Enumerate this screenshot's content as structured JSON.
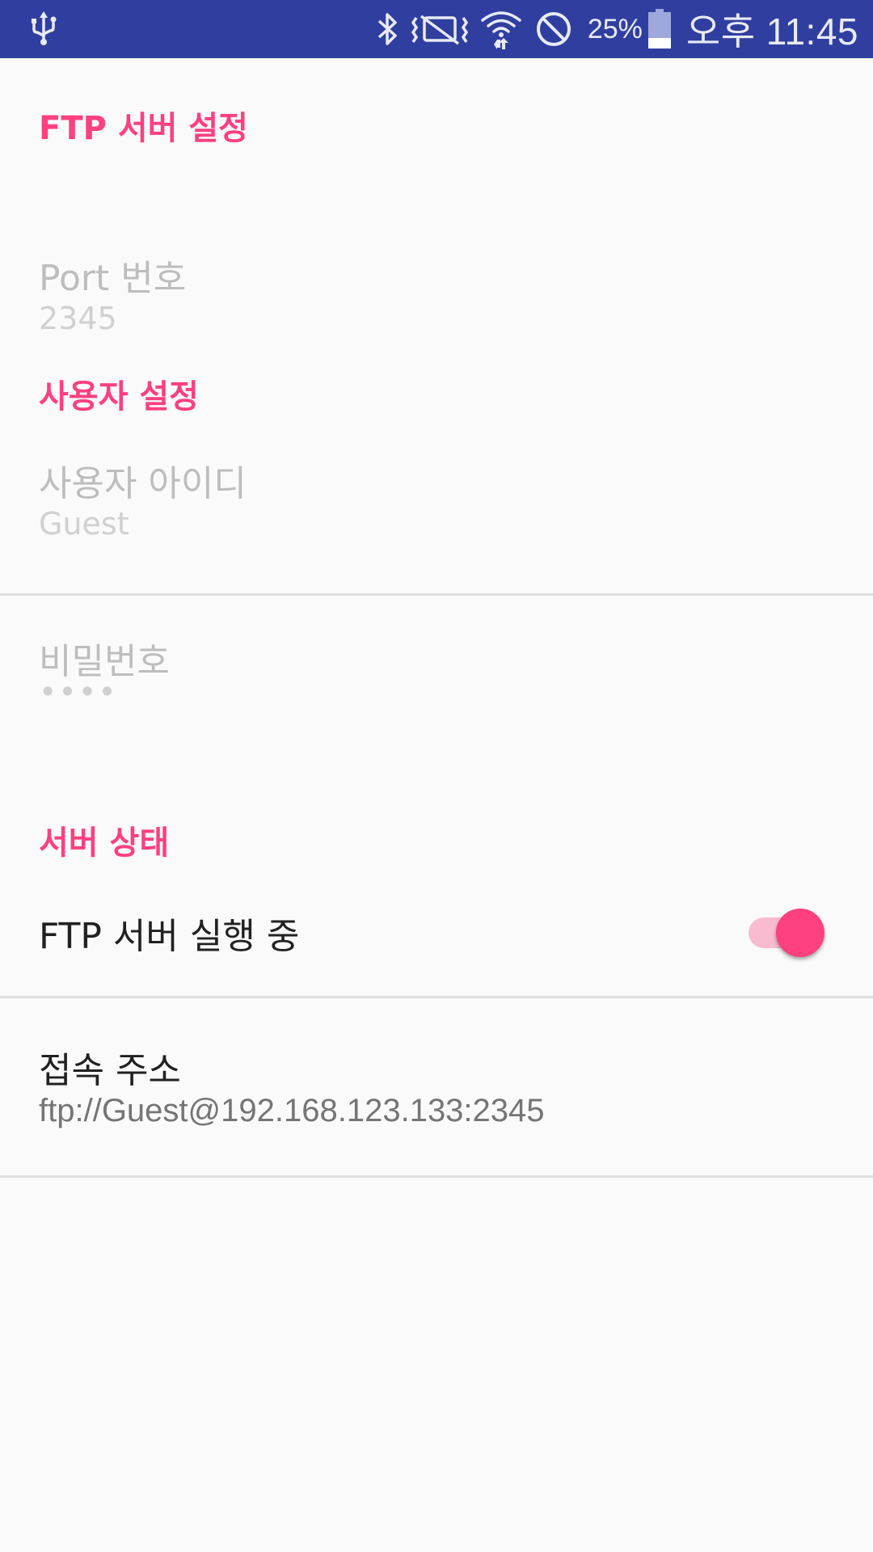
{
  "status_bar": {
    "battery_percent": "25%",
    "time": "오후 11:45",
    "icons": [
      "usb-icon",
      "bluetooth-icon",
      "vibrate-icon",
      "wifi-icon",
      "do-not-disturb-icon",
      "battery-icon"
    ],
    "background_color": "#303f9f"
  },
  "settings": {
    "accent_color": "#ff4081",
    "ftp_category": {
      "title": "FTP 서버 설정",
      "port": {
        "title": "Port 번호",
        "summary": "2345"
      }
    },
    "user_category": {
      "title": "사용자 설정",
      "user_id": {
        "title": "사용자 아이디",
        "summary": "Guest"
      },
      "password": {
        "title": "비밀번호",
        "summary": "••••"
      }
    },
    "status_category": {
      "title": "서버 상태",
      "running": {
        "title": "FTP 서버 실행 중",
        "enabled": true
      },
      "address": {
        "title": "접속 주소",
        "summary": "ftp://Guest@192.168.123.133:2345"
      }
    }
  }
}
